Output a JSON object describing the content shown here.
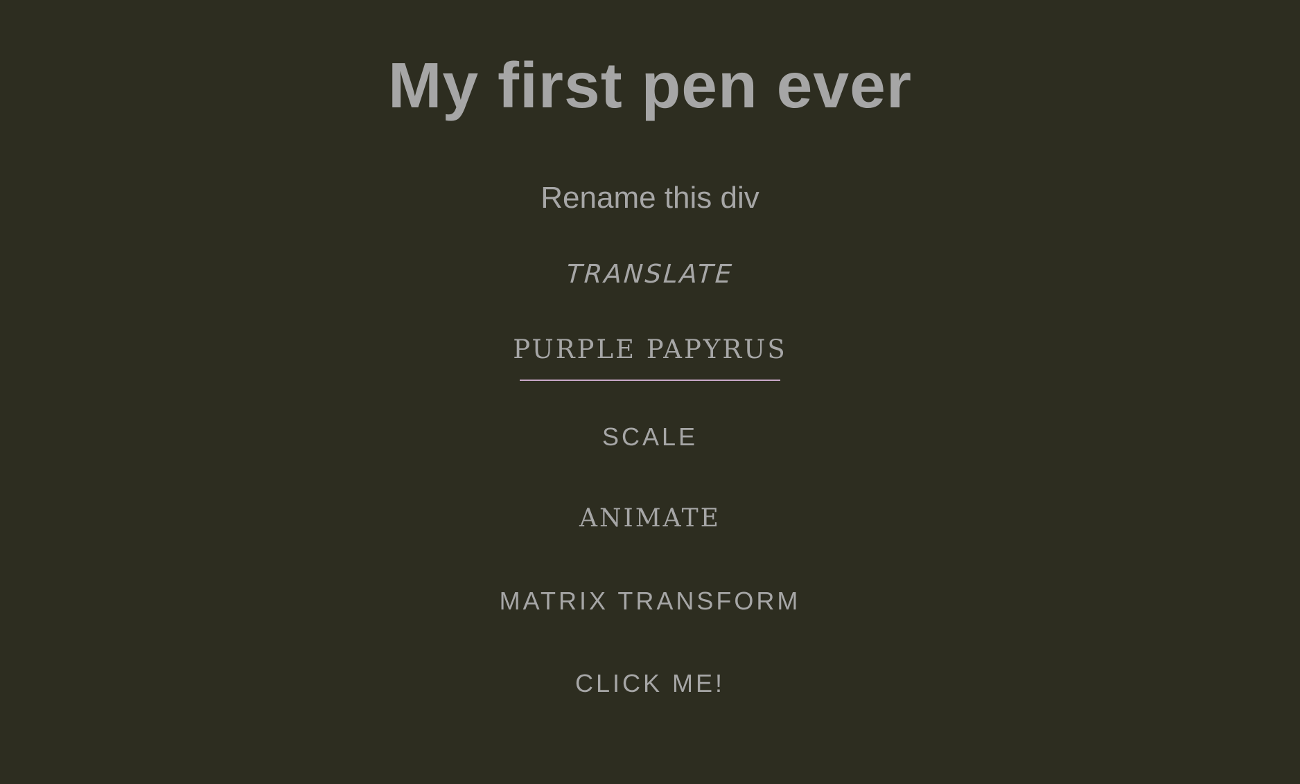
{
  "header": {
    "title": "My first pen ever"
  },
  "rename_div": {
    "label": "Rename this div"
  },
  "menu": {
    "items": [
      {
        "label": "Translate"
      },
      {
        "label": "Purple Papyrus"
      },
      {
        "label": "Scale"
      },
      {
        "label": "Animate"
      },
      {
        "label": "Matrix Transform"
      },
      {
        "label": "Click Me!"
      }
    ]
  },
  "colors": {
    "background": "#2d2d20",
    "text": "#a6a6a6",
    "underline_accent": "#c9a8c9"
  }
}
